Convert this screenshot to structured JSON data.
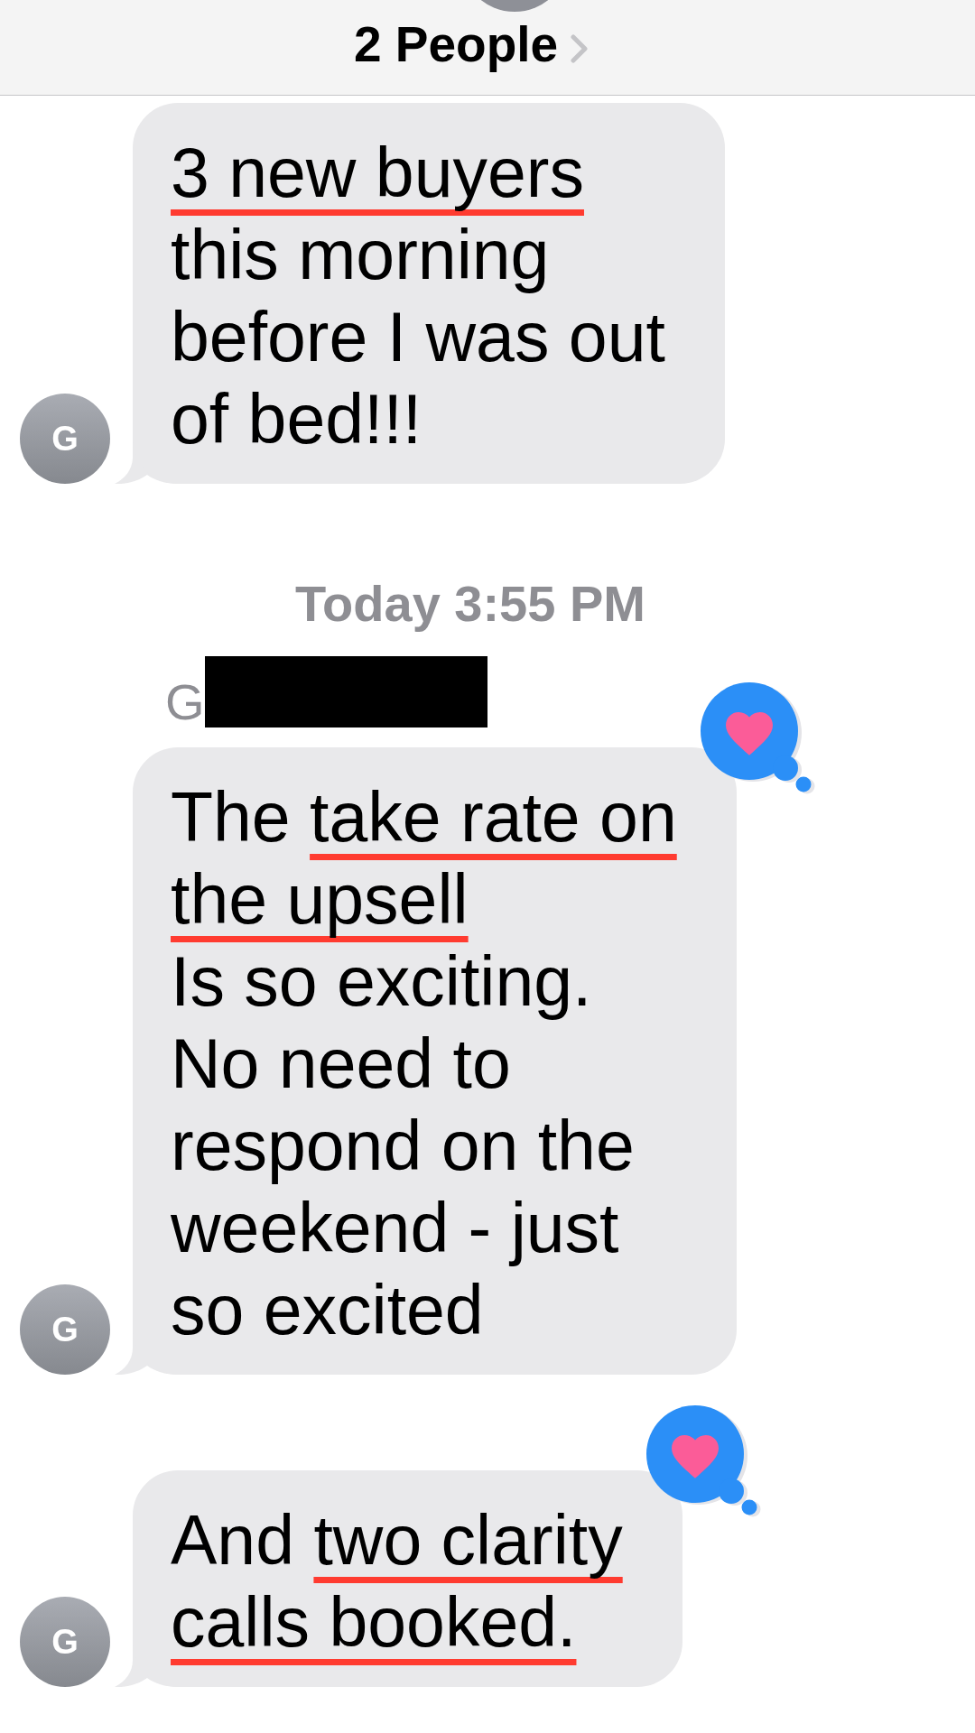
{
  "header": {
    "title": "2 People"
  },
  "thread": [
    {
      "kind": "message",
      "avatar": "G",
      "reacted": false,
      "lines": [
        [
          {
            "text": "3 new buyers",
            "underline": true
          }
        ],
        [
          {
            "text": "this morning",
            "underline": false
          }
        ],
        [
          {
            "text": "before I was out",
            "underline": false
          }
        ],
        [
          {
            "text": "of bed!!!",
            "underline": false
          }
        ]
      ]
    },
    {
      "kind": "timestamp",
      "text": "Today 3:55 PM"
    },
    {
      "kind": "sender",
      "name": "G",
      "redacted": true
    },
    {
      "kind": "message",
      "avatar": "G",
      "reacted": true,
      "lines": [
        [
          {
            "text": "The ",
            "underline": false
          },
          {
            "text": "take rate on",
            "underline": true
          }
        ],
        [
          {
            "text": "the upsell",
            "underline": true
          }
        ],
        [
          {
            "text": "Is so exciting.",
            "underline": false
          }
        ],
        [
          {
            "text": "No need to",
            "underline": false
          }
        ],
        [
          {
            "text": "respond on the",
            "underline": false
          }
        ],
        [
          {
            "text": "weekend - just",
            "underline": false
          }
        ],
        [
          {
            "text": "so excited",
            "underline": false
          }
        ]
      ]
    },
    {
      "kind": "message",
      "avatar": "G",
      "reacted": true,
      "lines": [
        [
          {
            "text": "And ",
            "underline": false
          },
          {
            "text": "two clarity",
            "underline": true
          }
        ],
        [
          {
            "text": "calls booked.",
            "underline": true
          }
        ]
      ]
    }
  ]
}
